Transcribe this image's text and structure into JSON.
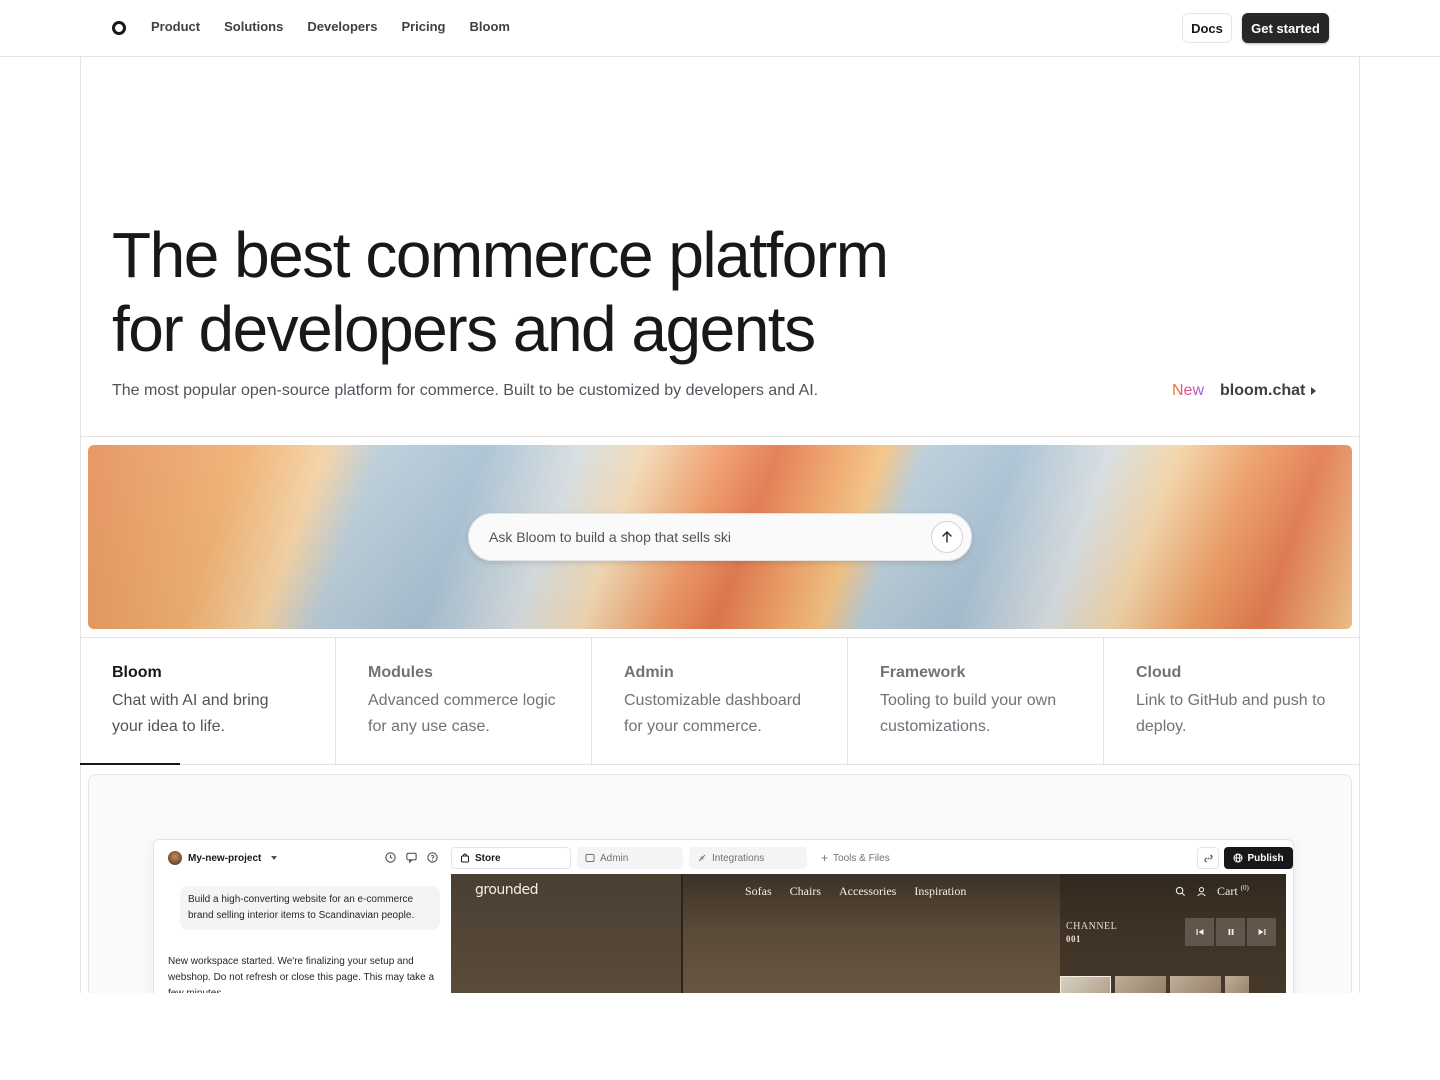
{
  "nav": {
    "logo": "logo-icon",
    "links": [
      "Product",
      "Solutions",
      "Developers",
      "Pricing",
      "Bloom"
    ],
    "docs_label": "Docs",
    "get_started_label": "Get started"
  },
  "hero": {
    "headline_line1": "The best commerce platform",
    "headline_line2": "for developers and agents",
    "subtitle": "The most popular open-source platform for commerce. Built to be customized by developers and AI.",
    "new_badge": "New",
    "new_link": "bloom.chat"
  },
  "ask": {
    "placeholder": "Ask Bloom to build a shop that sells ski"
  },
  "tabs": [
    {
      "title": "Bloom",
      "desc": "Chat with AI and bring your idea to life.",
      "active": true
    },
    {
      "title": "Modules",
      "desc": "Advanced commerce logic for any use case."
    },
    {
      "title": "Admin",
      "desc": "Customizable dashboard for your commerce."
    },
    {
      "title": "Framework",
      "desc": "Tooling to build your own customizations."
    },
    {
      "title": "Cloud",
      "desc": "Link to GitHub and push to deploy."
    }
  ],
  "preview": {
    "project_name": "My-new-project",
    "app_tabs": [
      "Store",
      "Admin",
      "Integrations",
      "Tools & Files"
    ],
    "publish_label": "Publish",
    "prompt_bubble": "Build a high-converting website for an e-commerce brand selling interior items to Scandinavian people.",
    "chat_message": "New workspace started. We're finalizing your setup and webshop. Do not refresh or close this page. This may take a few minutes.",
    "store": {
      "logo": "grounded",
      "nav": [
        "Sofas",
        "Chairs",
        "Accessories",
        "Inspiration"
      ],
      "cart_label": "Cart",
      "cart_count": "(0)",
      "channel_label": "CHANNEL",
      "channel_number": "001"
    }
  },
  "colors": {
    "accent_dark": "#18181b",
    "border": "#e4e4e7",
    "muted_text": "#71717a"
  }
}
